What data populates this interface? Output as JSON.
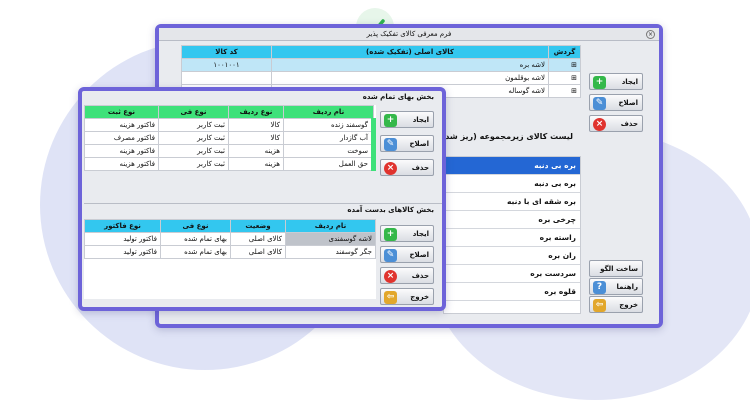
{
  "back_window": {
    "title": "فرم معرفی کالای تفکیک پذیر",
    "grid": {
      "headers": [
        "گردش",
        "کالای اصلی (تفکیک شده)",
        "کد کالا"
      ],
      "rows": [
        {
          "name": "لاشه بره",
          "code": "۱۰۰۱۰۰۱"
        },
        {
          "name": "لاشه بوقلمون",
          "code": ""
        },
        {
          "name": "لاشه گوساله",
          "code": ""
        }
      ]
    },
    "buttons": {
      "create": "ایجاد",
      "edit": "اصلاح",
      "delete": "حذف"
    },
    "sub_list_title": "لیست کالای زیرمجموعه (ریز شده)",
    "sub_list_items": [
      "بره بی دنبه",
      "بره بی دنبه",
      "بره شقه ای با دنبه",
      "چرخی بره",
      "راسته بره",
      "ران بره",
      "سردست بره",
      "قلوه بره"
    ],
    "bottom_buttons": {
      "build_pattern": "ساخت الگو",
      "guide": "راهنما",
      "exit": "خروج"
    }
  },
  "front_window": {
    "section1": {
      "title": "بخش بهای تمام شده",
      "headers": [
        "نام ردیف",
        "نوع ردیف",
        "نوع فی",
        "نوع ثبت"
      ],
      "rows": [
        [
          "گوسفند زنده",
          "کالا",
          "ثبت کاربر",
          "فاکتور هزینه"
        ],
        [
          "آب گازدار",
          "کالا",
          "ثبت کاربر",
          "فاکتور مصرف"
        ],
        [
          "سوخت",
          "هزینه",
          "ثبت کاربر",
          "فاکتور هزینه"
        ],
        [
          "حق العمل",
          "هزینه",
          "ثبت کاربر",
          "فاکتور هزینه"
        ]
      ],
      "buttons": {
        "create": "ایجاد",
        "edit": "اصلاح",
        "delete": "حذف"
      }
    },
    "section2": {
      "title": "بخش کالاهای بدست آمده",
      "headers": [
        "نام ردیف",
        "وضعیت",
        "نوع فی",
        "نوع فاکتور"
      ],
      "rows": [
        [
          "لاشه گوسفندی",
          "کالای اصلی",
          "بهای تمام شده",
          "فاکتور تولید"
        ],
        [
          "جگر گوسفند",
          "کالای اصلی",
          "بهای تمام شده",
          "فاکتور تولید"
        ]
      ],
      "buttons": {
        "create": "ایجاد",
        "edit": "اصلاح",
        "delete": "حذف",
        "exit": "خروج"
      }
    }
  },
  "colors": {
    "frame": "#6d63d9",
    "header_green": "#3ee17a",
    "header_blue": "#33c7ef",
    "selection": "#2467d4"
  }
}
